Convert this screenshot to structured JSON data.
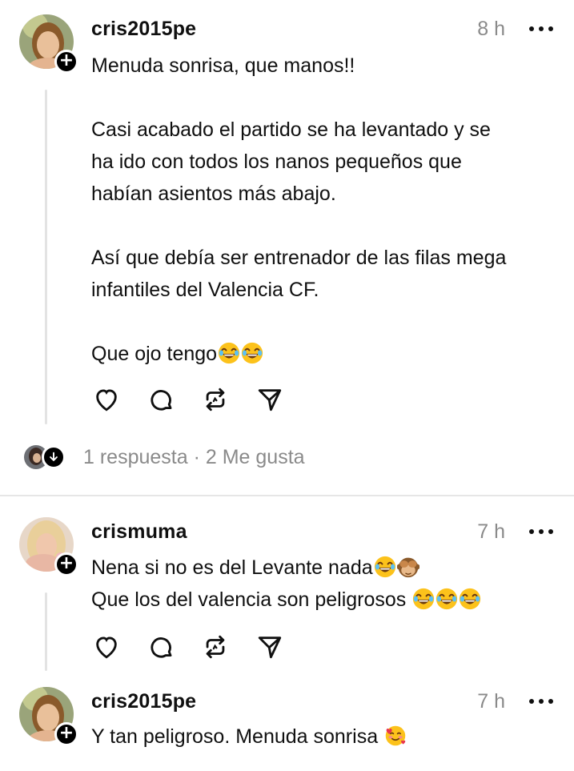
{
  "posts": [
    {
      "username": "cris2015pe",
      "time": "8 h",
      "lines": [
        "Menuda sonrisa, que manos!!",
        "",
        "Casi acabado el partido se ha levantado y se",
        "ha ido con todos los nanos pequeños que",
        "habían asientos más abajo.",
        "",
        "Así que debía ser entrenador de las filas mega",
        "infantiles del Valencia CF.",
        "",
        "Que ojo tengo"
      ],
      "emojis": [
        "laughing-emoji",
        "laughing-emoji"
      ]
    },
    {
      "username": "crismuma",
      "time": "7 h",
      "line1": "Nena si no es del Levante nada",
      "line1_emojis": [
        "laughing-emoji",
        "see-no-evil-monkey-emoji"
      ],
      "line2": "Que los del valencia son peligrosos ",
      "line2_emojis": [
        "laughing-emoji",
        "laughing-emoji",
        "laughing-emoji"
      ]
    },
    {
      "username": "cris2015pe",
      "time": "7 h",
      "line1": "Y tan peligroso. Menuda sonrisa ",
      "line1_emojis": [
        "smiling-face-with-hearts-emoji"
      ]
    }
  ],
  "replies_summary": "1 respuesta · 2 Me gusta",
  "actions": [
    "heart-icon",
    "comment-icon",
    "repost-icon",
    "share-icon"
  ],
  "colors": {
    "text": "#101010",
    "muted": "#8a8a8a",
    "thread_line": "#e3e3e3",
    "divider": "#e6e6e6"
  }
}
